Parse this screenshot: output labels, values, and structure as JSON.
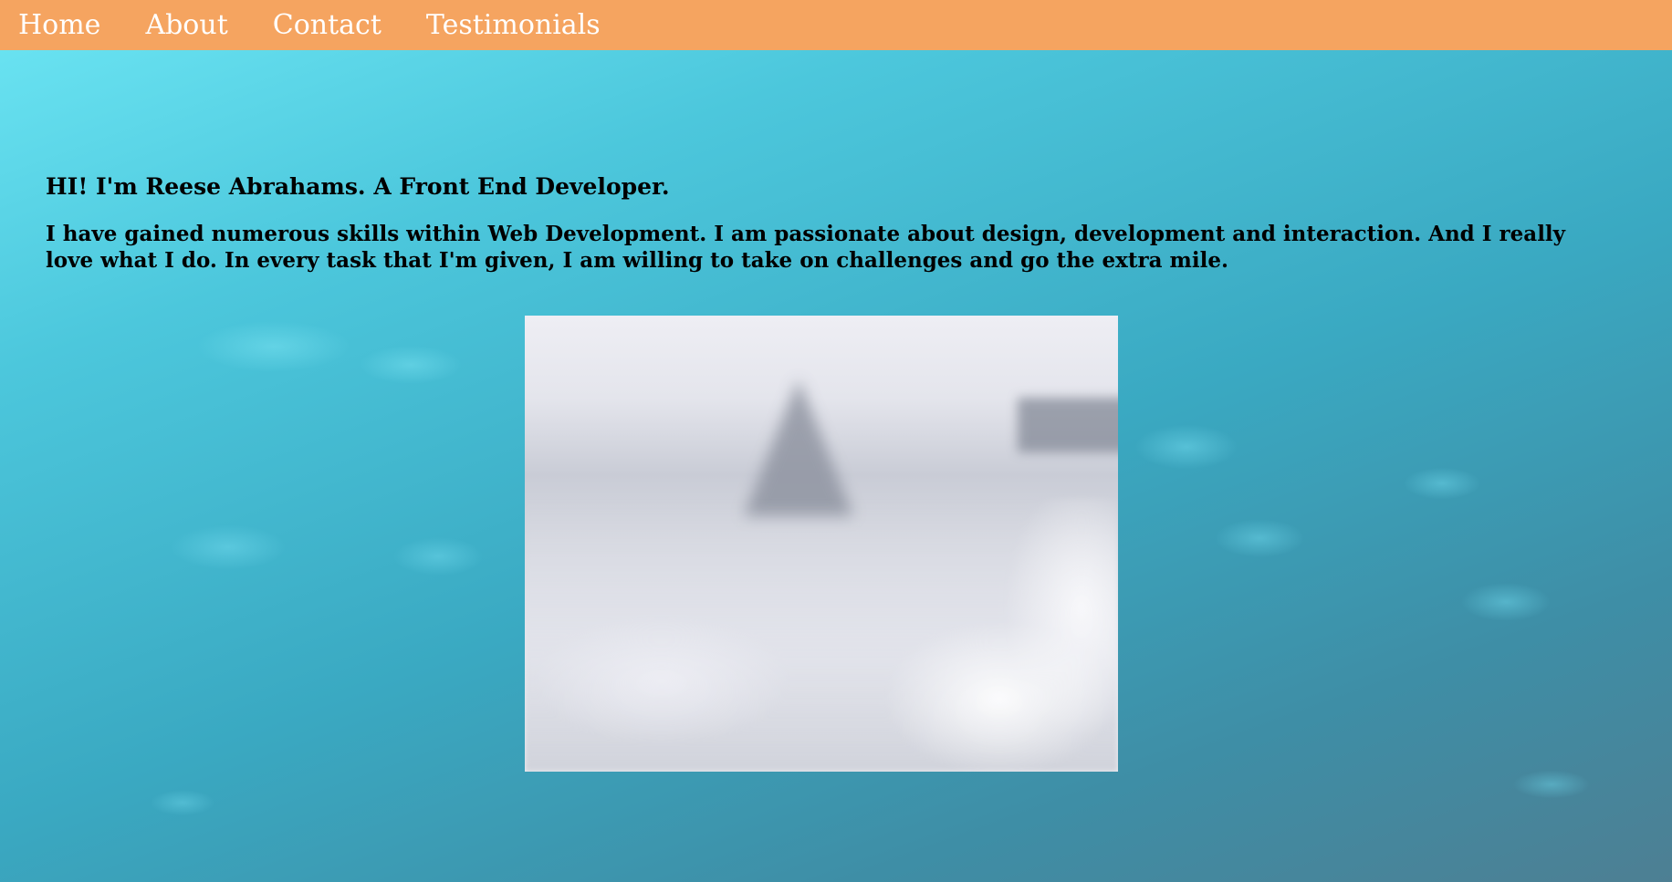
{
  "nav": {
    "items": [
      {
        "label": "Home"
      },
      {
        "label": "About"
      },
      {
        "label": "Contact"
      },
      {
        "label": "Testimonials"
      }
    ]
  },
  "hero": {
    "heading": "HI! I'm Reese Abrahams. A Front End Developer.",
    "text": "I have gained numerous skills within Web Development. I am passionate about design, development and interaction. And I really love what I do. In every task that I'm given, I am willing to take on challenges and go the extra mile."
  },
  "colors": {
    "navbar": "#f5a460",
    "nav_text": "#ffffff",
    "body_text": "#000000",
    "background": "#3aa9c2"
  },
  "icons": {
    "background": "water-droplets-background",
    "photo": "winter-frost-photo"
  }
}
